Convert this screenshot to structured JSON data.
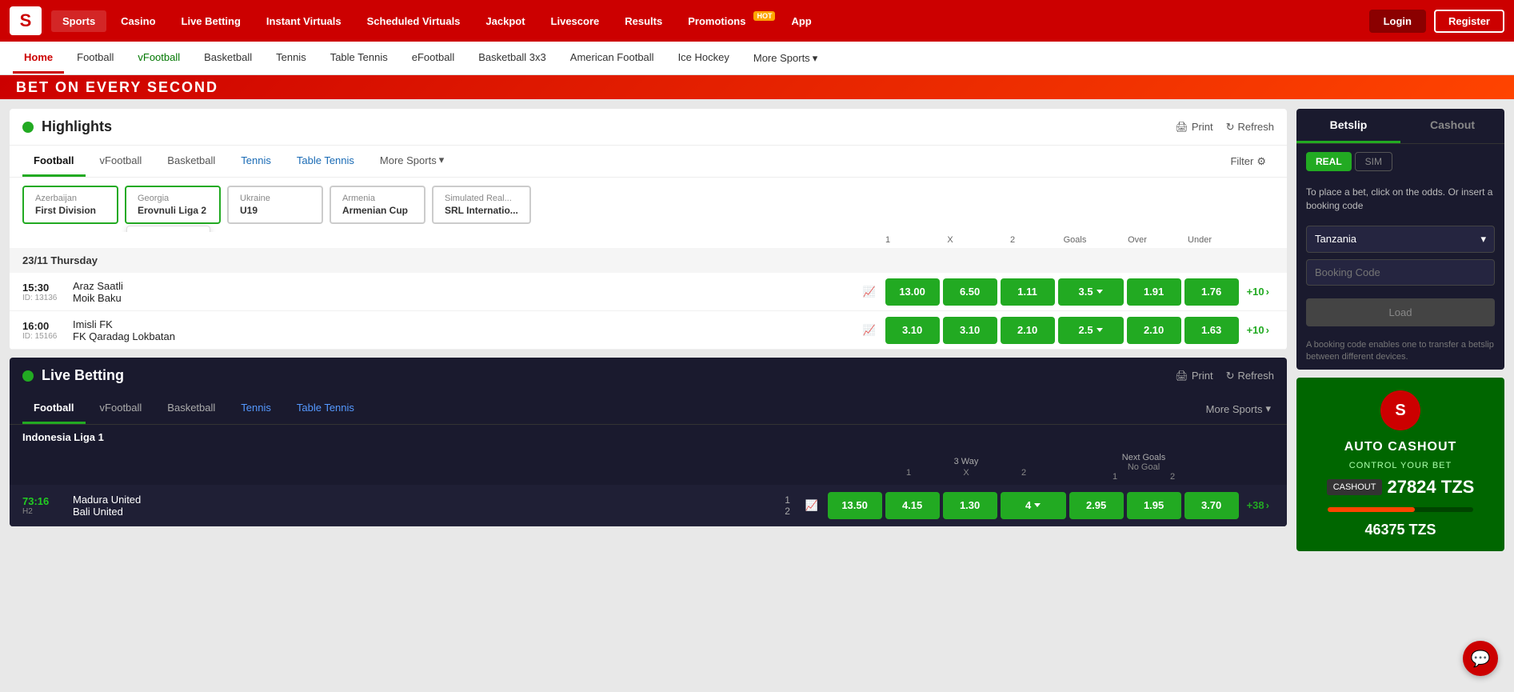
{
  "brand": {
    "logo": "S",
    "color": "#cc0000"
  },
  "top_nav": {
    "items": [
      {
        "label": "Sports",
        "active": true
      },
      {
        "label": "Casino",
        "active": false
      },
      {
        "label": "Live Betting",
        "active": false
      },
      {
        "label": "Instant Virtuals",
        "active": false
      },
      {
        "label": "Scheduled Virtuals",
        "active": false
      },
      {
        "label": "Jackpot",
        "active": false
      },
      {
        "label": "Livescore",
        "active": false
      },
      {
        "label": "Results",
        "active": false
      },
      {
        "label": "Promotions",
        "active": false
      },
      {
        "label": "App",
        "active": false,
        "hot": true
      }
    ],
    "login": "Login",
    "register": "Register"
  },
  "second_nav": {
    "items": [
      {
        "label": "Home",
        "active": true
      },
      {
        "label": "Football",
        "active": false
      },
      {
        "label": "vFootball",
        "active": false,
        "green": true
      },
      {
        "label": "Basketball",
        "active": false
      },
      {
        "label": "Tennis",
        "active": false
      },
      {
        "label": "Table Tennis",
        "active": false
      },
      {
        "label": "eFootball",
        "active": false
      },
      {
        "label": "Basketball 3x3",
        "active": false
      },
      {
        "label": "American Football",
        "active": false
      },
      {
        "label": "Ice Hockey",
        "active": false
      },
      {
        "label": "More Sports",
        "active": false,
        "has_arrow": true
      }
    ]
  },
  "banner": {
    "text": "BET ON EVERY SECOND"
  },
  "highlights": {
    "title": "Highlights",
    "print_label": "Print",
    "refresh_label": "Refresh",
    "tabs": [
      {
        "label": "Football",
        "active": true
      },
      {
        "label": "vFootball",
        "active": false
      },
      {
        "label": "Basketball",
        "active": false
      },
      {
        "label": "Tennis",
        "active": false,
        "blue": true
      },
      {
        "label": "Table Tennis",
        "active": false,
        "blue": true
      },
      {
        "label": "More Sports",
        "active": false,
        "has_arrow": true
      },
      {
        "label": "Filter",
        "is_filter": true
      }
    ],
    "league_tabs": [
      {
        "country": "Azerbaijan",
        "name": "First Division",
        "active": true
      },
      {
        "country": "Georgia",
        "name": "Erovnuli Liga 2",
        "active": true,
        "tooltip": {
          "country": "Georgia",
          "name": "Erovnuli Liga 2"
        }
      },
      {
        "country": "Ukraine",
        "name": "U19",
        "active": false
      },
      {
        "country": "Armenia",
        "name": "Armenian Cup",
        "active": false
      },
      {
        "country": "Simulated Real...",
        "name": "SRL Internatio...",
        "active": false
      }
    ],
    "date_label": "23/11 Thursday",
    "odds_headers": {
      "col1": "1",
      "colX": "X",
      "col2": "2",
      "goals": "Goals",
      "over": "Over",
      "under": "Under"
    },
    "matches": [
      {
        "time": "15:30",
        "id": "ID: 13136",
        "team1": "Araz Saatli",
        "team2": "Moik Baku",
        "odds": [
          "13.00",
          "6.50",
          "1.11"
        ],
        "goals_line": "3.5",
        "over": "1.91",
        "under": "1.76",
        "more": "+10"
      },
      {
        "time": "16:00",
        "id": "ID: 15166",
        "team1": "Imisli FK",
        "team2": "FK Qaradag Lokbatan",
        "odds": [
          "3.10",
          "3.10",
          "2.10"
        ],
        "goals_line": "2.5",
        "over": "2.10",
        "under": "1.63",
        "more": "+10"
      }
    ]
  },
  "live_betting": {
    "title": "Live Betting",
    "print_label": "Print",
    "refresh_label": "Refresh",
    "tabs": [
      {
        "label": "Football",
        "active": true
      },
      {
        "label": "vFootball",
        "active": false
      },
      {
        "label": "Basketball",
        "active": false
      },
      {
        "label": "Tennis",
        "active": false,
        "blue": true
      },
      {
        "label": "Table Tennis",
        "active": false,
        "blue": true
      },
      {
        "label": "More Sports",
        "active": false,
        "has_arrow": true
      }
    ],
    "league": "Indonesia Liga 1",
    "col_headers": {
      "three_way": "3 Way",
      "col1": "1",
      "colX": "X",
      "col2": "2",
      "next_goals": "Next Goals",
      "no_goal_label": "No Goal",
      "ng_col1": "1",
      "ng_col2": "2"
    },
    "matches": [
      {
        "time": "73:16",
        "period": "H2",
        "score1": "1",
        "score2": "2",
        "team1": "Madura United",
        "team2": "Bali United",
        "odds": [
          "13.50",
          "4.15",
          "1.30"
        ],
        "goals_line": "4",
        "over": "2.95",
        "under": "1.95",
        "under2": "3.70",
        "more": "+38"
      }
    ]
  },
  "betslip": {
    "title": "Betslip",
    "cashout_label": "Cashout",
    "real_label": "REAL",
    "sim_label": "SIM",
    "info_text": "To place a bet, click on the odds. Or insert a booking code",
    "country_value": "Tanzania",
    "booking_placeholder": "Booking Code",
    "load_label": "Load",
    "footer_text": "A booking code enables one to transfer a betslip between different devices."
  },
  "promo": {
    "logo": "S",
    "title": "AUTO CASHOUT",
    "subtitle": "CONTROL YOUR BET",
    "cashout_label": "CASHOUT",
    "amount1": "27824 TZS",
    "amount2": "46375 TZS"
  },
  "icons": {
    "chevron": "▾",
    "print": "⊟",
    "refresh": "↻",
    "chart": "📈",
    "arrow_right": "›",
    "chat": "💬"
  }
}
